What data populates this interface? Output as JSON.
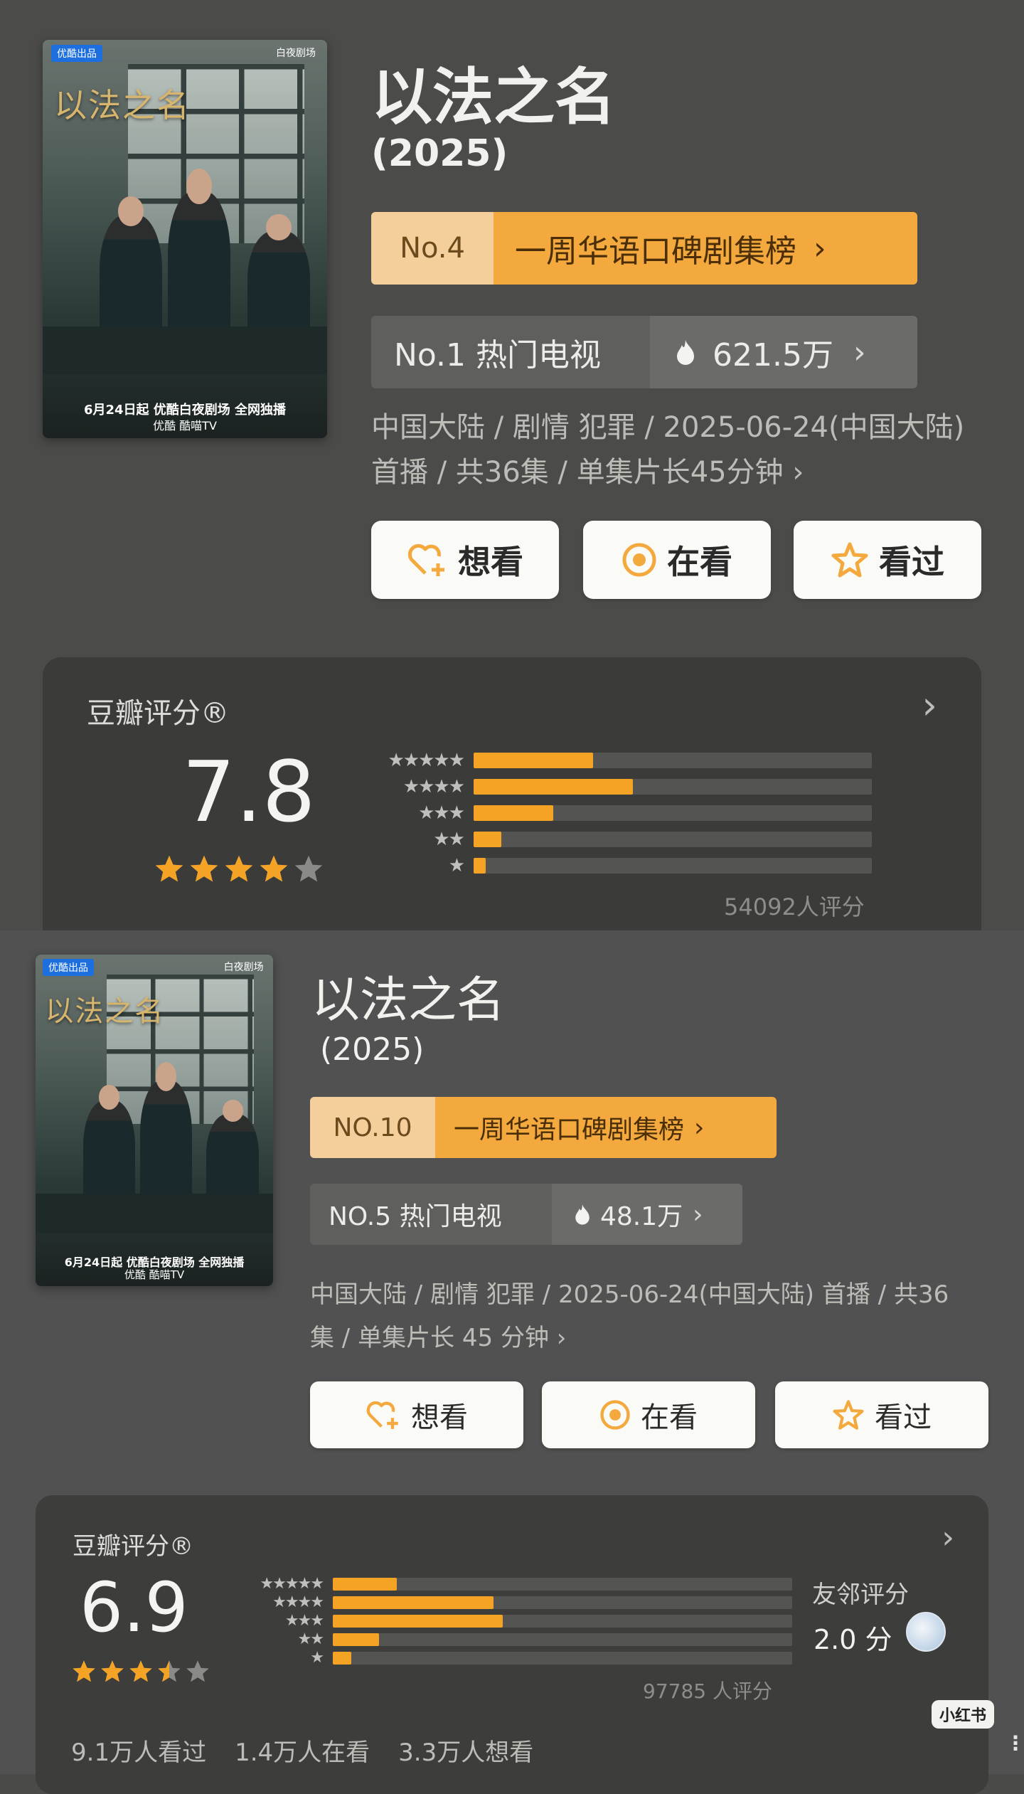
{
  "top": {
    "poster": {
      "badge": "优酷出品",
      "brand": "白夜剧场",
      "title_art": "以法之名",
      "release_line": "6月24日起 优酷白夜剧场 全网独播",
      "platforms": "优酷  酷喵TV"
    },
    "title": "以法之名",
    "year": "(2025)",
    "rank": {
      "num": "No.4",
      "name": "一周华语口碑剧集榜",
      "chev": "›"
    },
    "hot": {
      "label": "No.1 热门电视",
      "value": "621.5万",
      "chev": "›"
    },
    "meta": "中国大陆 / 剧情 犯罪 / 2025-06-24(中国大陆)首播 / 共36集 / 单集片长45分钟 ›",
    "buttons": {
      "want": "想看",
      "watching": "在看",
      "watched": "看过"
    },
    "score": {
      "label": "豆瓣评分®",
      "chev": "›",
      "value": "7.8",
      "stars_rating": 4,
      "distribution": [
        0.3,
        0.4,
        0.2,
        0.07,
        0.03
      ],
      "count": "54092人评分"
    }
  },
  "bottom": {
    "poster": {
      "badge": "优酷出品",
      "brand": "白夜剧场",
      "title_art": "以法之名",
      "release_line": "6月24日起 优酷白夜剧场 全网独播",
      "platforms": "优酷  酷喵TV"
    },
    "title": "以法之名",
    "year": "(2025)",
    "rank": {
      "num": "NO.10",
      "name": "一周华语口碑剧集榜",
      "chev": "›"
    },
    "hot": {
      "label": "NO.5 热门电视",
      "value": "48.1万",
      "chev": "›"
    },
    "meta": "中国大陆 / 剧情 犯罪 / 2025-06-24(中国大陆) 首播 / 共36集 / 单集片长 45 分钟 ›",
    "buttons": {
      "want": "想看",
      "watching": "在看",
      "watched": "看过"
    },
    "score": {
      "label": "豆瓣评分®",
      "chev": "›",
      "value": "6.9",
      "stars_rating": 3.5,
      "distribution": [
        0.14,
        0.35,
        0.37,
        0.1,
        0.04
      ],
      "count": "97785 人评分",
      "neighbor_label": "友邻评分",
      "neighbor_value": "2.0 分"
    },
    "stats": {
      "watched": "9.1万人看过",
      "watching": "1.4万人在看",
      "want": "3.3万人想看"
    }
  },
  "watermark": "小红书",
  "colors": {
    "accent_orange": "#f3a93d",
    "rank_num_bg": "#f5cf9b",
    "star": "#f5a324"
  }
}
